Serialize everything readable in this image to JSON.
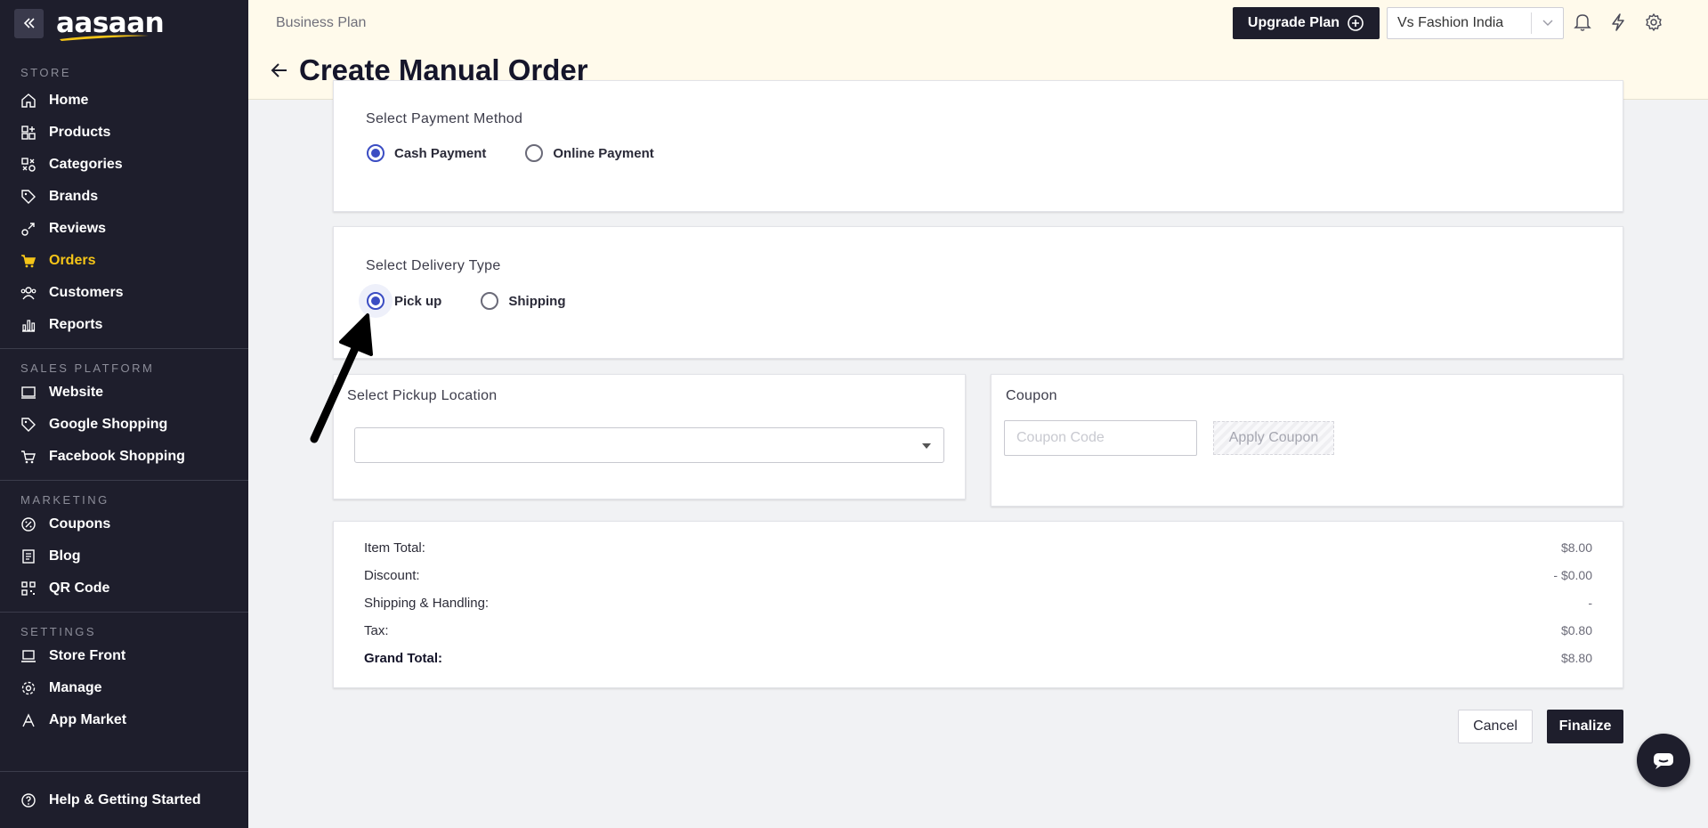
{
  "app": {
    "logo_text": "aasaan",
    "logo_accent": "#f5c518"
  },
  "sidebar": {
    "sections": [
      {
        "title": "STORE"
      },
      {
        "title": "SALES PLATFORM"
      },
      {
        "title": "MARKETING"
      },
      {
        "title": "SETTINGS"
      }
    ],
    "items": {
      "home": "Home",
      "products": "Products",
      "categories": "Categories",
      "brands": "Brands",
      "reviews": "Reviews",
      "orders": "Orders",
      "customers": "Customers",
      "reports": "Reports",
      "website": "Website",
      "google_shopping": "Google Shopping",
      "facebook_shopping": "Facebook Shopping",
      "coupons": "Coupons",
      "blog": "Blog",
      "qr_code": "QR Code",
      "store_front": "Store Front",
      "manage": "Manage",
      "app_market": "App Market"
    },
    "active_item": "Orders",
    "help": "Help & Getting Started"
  },
  "header": {
    "plan": "Business Plan",
    "title": "Create Manual Order",
    "upgrade_label": "Upgrade Plan",
    "store_name": "Vs Fashion India"
  },
  "payment": {
    "title": "Select Payment Method",
    "options": [
      "Cash Payment",
      "Online Payment"
    ],
    "selected": "Cash Payment"
  },
  "delivery": {
    "title": "Select Delivery Type",
    "options": [
      "Pick up",
      "Shipping"
    ],
    "selected": "Pick up"
  },
  "pickup": {
    "title": "Select Pickup Location",
    "value": ""
  },
  "coupon": {
    "title": "Coupon",
    "placeholder": "Coupon Code",
    "apply_label": "Apply Coupon"
  },
  "summary": {
    "item_total_label": "Item Total:",
    "item_total": "$8.00",
    "discount_label": "Discount:",
    "discount": "- $0.00",
    "shipping_label": "Shipping & Handling:",
    "shipping": "-",
    "tax_label": "Tax:",
    "tax": "$0.80",
    "grand_total_label": "Grand Total:",
    "grand_total": "$8.80"
  },
  "actions": {
    "cancel": "Cancel",
    "finalize": "Finalize"
  },
  "icons": {
    "collapse": "double-chevron-left-icon",
    "back": "arrow-left-icon",
    "upgrade": "plus-circle-icon",
    "bell": "bell-icon",
    "bolt": "lightning-icon",
    "settings": "gear-icon",
    "chat": "chat-icon"
  }
}
